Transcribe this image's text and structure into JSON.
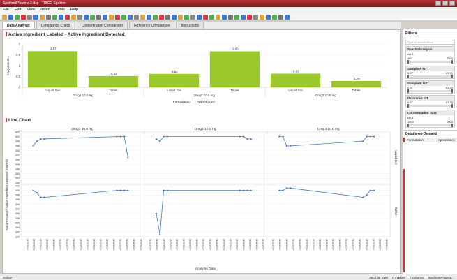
{
  "window": {
    "title": "Spotfire8Pharma-2.dxp - TIBCO Spotfire"
  },
  "menu": [
    "File",
    "Edit",
    "View",
    "Insert",
    "Tools",
    "Help"
  ],
  "tabs": [
    {
      "label": "Data Analysis",
      "active": true
    },
    {
      "label": "Compliance Check",
      "active": false
    },
    {
      "label": "Concentration Comparison",
      "active": false
    },
    {
      "label": "Reference Comparison",
      "active": false
    },
    {
      "label": "Instructions",
      "active": false
    }
  ],
  "bar_panel": {
    "title": "Active Ingredient Labeled - Active Ingredient Detected",
    "axis_selector_label": "Formulation",
    "axis_selector2_label": "Appearance"
  },
  "line_panel": {
    "title": "Line Chart",
    "x_axis_label": "Analysis Date",
    "y_axis_label": "Sum(Amount of Active Ingredient Detected (mg/ml))",
    "row_labels": [
      "Liquid Gel",
      "Tablet"
    ],
    "x_tick_label": "11/12/2014"
  },
  "chart_data": [
    {
      "type": "bar",
      "ylabel": "Avg(Amount...",
      "ylim": [
        0,
        2
      ],
      "yticks": [
        "0",
        "0.5",
        "1",
        "1.5",
        "2"
      ],
      "groups": [
        "Drug1 10.0 mg",
        "Drug2 10.0 mg",
        "Drug3 10.0 mg"
      ],
      "categories": [
        "Liquid Gel",
        "Tablet",
        "Liquid Gel",
        "Tablet",
        "Liquid Gel",
        "Tablet"
      ],
      "values": [
        1.67,
        0.52,
        0.62,
        1.66,
        0.63,
        0.29
      ],
      "labels": [
        "1.67",
        "0.52",
        "0.62",
        "1.66",
        "0.63",
        "0.29"
      ],
      "color": "#9bc92b"
    },
    {
      "type": "line",
      "panels": [
        "Drug1 10.0 mg",
        "Drug2 10.0 mg",
        "Drug3 10.0 mg"
      ],
      "rows": [
        "Liquid Gel",
        "Tablet"
      ],
      "yticks": [
        "380",
        "382",
        "384",
        "386",
        "388",
        "390",
        "392",
        "394",
        "396",
        "398",
        "400",
        "402"
      ],
      "ylim": [
        380,
        402
      ],
      "color": "#4a7ab8",
      "series": [
        {
          "panel": 0,
          "row": 0,
          "values": [
            396,
            398,
            399,
            399,
            400,
            400,
            400,
            391
          ]
        },
        {
          "panel": 1,
          "row": 0,
          "values": [
            399,
            398,
            400,
            400,
            400,
            400,
            399,
            399
          ]
        },
        {
          "panel": 2,
          "row": 0,
          "values": [
            400,
            400,
            396,
            396,
            398,
            400,
            400,
            400
          ]
        },
        {
          "panel": 0,
          "row": 1,
          "values": [
            400,
            399,
            397,
            397,
            400,
            400,
            400,
            400
          ]
        },
        {
          "panel": 1,
          "row": 1,
          "values": [
            390,
            381,
            400,
            400,
            400,
            400,
            400,
            400
          ]
        },
        {
          "panel": 2,
          "row": 1,
          "values": [
            400,
            400,
            401,
            401,
            397,
            398,
            400,
            400
          ]
        }
      ]
    }
  ],
  "sidebar": {
    "title": "Filters",
    "search_placeholder": "Type to search filters",
    "filters": [
      {
        "header": "Spectralanalysis",
        "label": "cm-1",
        "min": "450",
        "max": "7800"
      },
      {
        "header": "Sample A %T",
        "label": "",
        "min": "0.37",
        "max": "83.70"
      },
      {
        "header": "Sample B %T",
        "label": "",
        "min": "0.37",
        "max": "83.70"
      },
      {
        "header": "Reference %T",
        "label": "",
        "min": "0.37",
        "max": "83.70"
      },
      {
        "header": "Concentration Data",
        "label": "cm-1",
        "min": "1500",
        "max": "2000"
      }
    ],
    "dod_title": "Details-on-Demand",
    "dod_col1": "Formulation",
    "dod_col2": "Appearance"
  },
  "status": {
    "left": "Online",
    "rows": "36 of 36 rows",
    "marked": "0 marked",
    "columns": "7 columns",
    "file": "Spotfire8Pharma..."
  }
}
